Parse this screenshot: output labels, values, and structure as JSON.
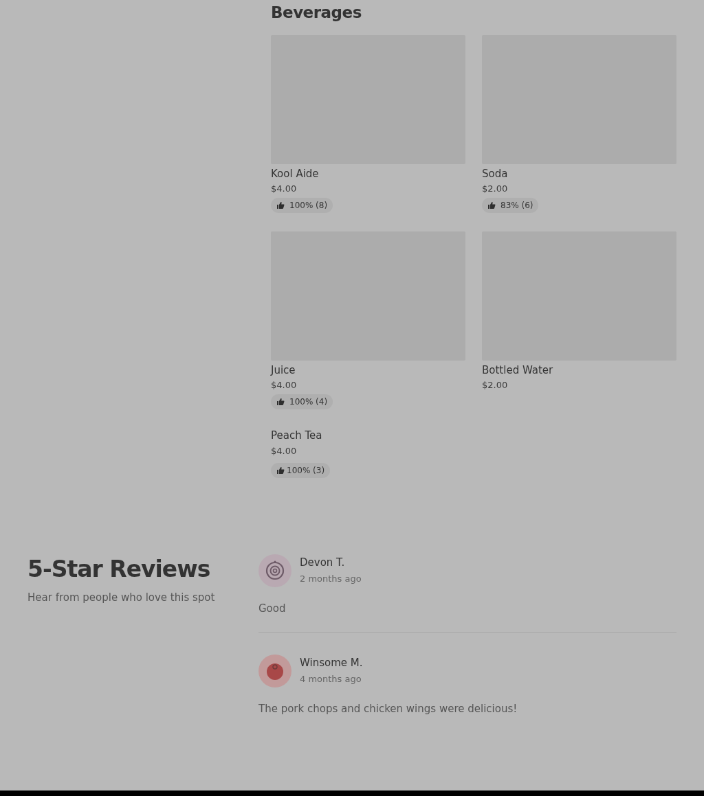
{
  "menu_section": {
    "title": "Beverages",
    "items": [
      {
        "name": "Kool Aide",
        "price": "$4.00",
        "kind": "photo",
        "rating": "100% (8)"
      },
      {
        "name": "Soda",
        "price": "$2.00",
        "kind": "photo",
        "rating": "83% (6)"
      },
      {
        "name": "Juice",
        "price": "$4.00",
        "kind": "photo",
        "rating": "100% (4)"
      },
      {
        "name": "Bottled Water",
        "price": "$2.00",
        "kind": "photo"
      },
      {
        "name": "Peach Tea",
        "price": "$4.00",
        "kind": "plain",
        "rating": "100% (3)"
      }
    ]
  },
  "reviews": {
    "title": "5-Star Reviews",
    "subtitle": "Hear from people who love this spot",
    "items": [
      {
        "author": "Devon T.",
        "time": "2 months ago",
        "text": "Good",
        "kind": "rings"
      },
      {
        "author": "Winsome M.",
        "time": "4 months ago",
        "text": "The pork chops and chicken wings were delicious!",
        "kind": "ball"
      }
    ]
  }
}
